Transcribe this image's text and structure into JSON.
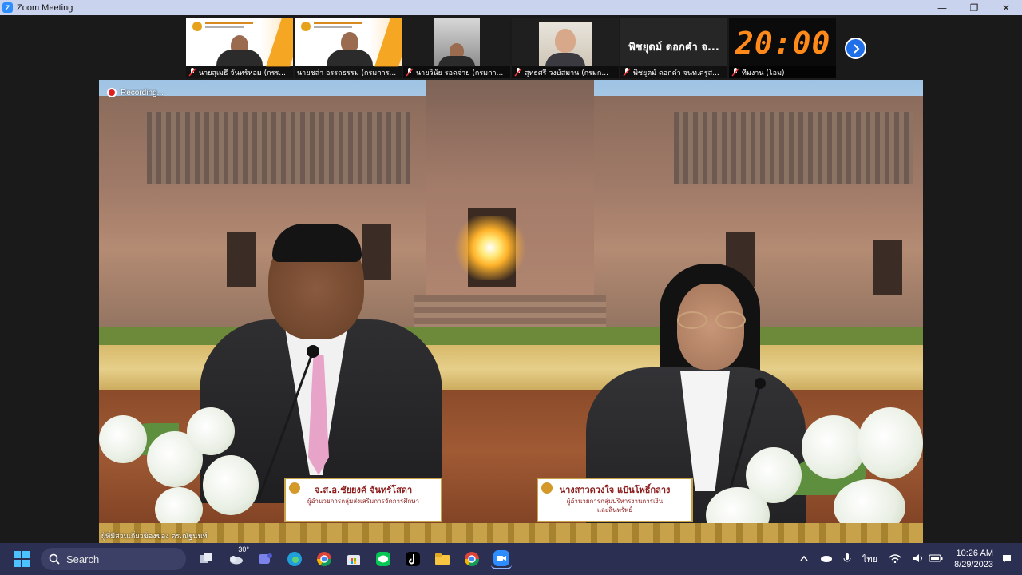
{
  "window": {
    "app_icon": "zoom-logo-icon",
    "app_letter": "Z",
    "title": "Zoom Meeting",
    "controls": [
      "—",
      "❐",
      "✕"
    ]
  },
  "thumbnails": [
    {
      "name": "นายสุเมธี จันทร์หอม (กรร...",
      "muted": true
    },
    {
      "name": "นายชล่า อรรถธรรม (กรมการ...",
      "muted": true
    },
    {
      "name": "นายวินัย รอดจ่าย (กรมกา...",
      "muted": true
    },
    {
      "name": "สุทธศรี วงษ์สมาน (กรมก...",
      "muted": true
    },
    {
      "name": "พิชยุตม์ ดอกคำ จนท.ครูส...",
      "muted": true,
      "big_label": "พิชยุตม์ ดอกคำ จ..."
    },
    {
      "name": "ทีมงาน (โอม)",
      "muted": true,
      "clock": "20:00"
    }
  ],
  "main_video": {
    "recording_label": "Recording...",
    "speaker_label": "ผู้ที่มีส่วนเกี่ยวข้องของ ดร.ณัฐนนท์",
    "left_plate": {
      "name": "จ.ส.อ.ชัยยงค์ จันทร์โสดา",
      "title": "ผู้อำนวยการกลุ่มส่งเสริมการจัดการศึกษา"
    },
    "right_plate": {
      "name": "นางสาวดวงใจ แป้นโพธิ์กลาง",
      "title_line1": "ผู้อำนวยการกลุ่มบริหารงานการเงิน",
      "title_line2": "และสินทรัพย์"
    }
  },
  "taskbar": {
    "search_placeholder": "Search",
    "weather_temp": "30°",
    "pinned_icons": [
      "task-view-icon",
      "weather-icon",
      "teams-icon",
      "edge-icon",
      "chrome-icon",
      "store-icon",
      "line-icon",
      "tiktok-icon",
      "file-explorer-icon",
      "chrome-profile-icon",
      "zoom-icon"
    ],
    "tray": {
      "language": "ไทย",
      "time": "10:26 AM",
      "date": "8/29/2023"
    },
    "colors": {
      "bar": "#2b2f52",
      "accent": "#4cc2ff"
    }
  }
}
